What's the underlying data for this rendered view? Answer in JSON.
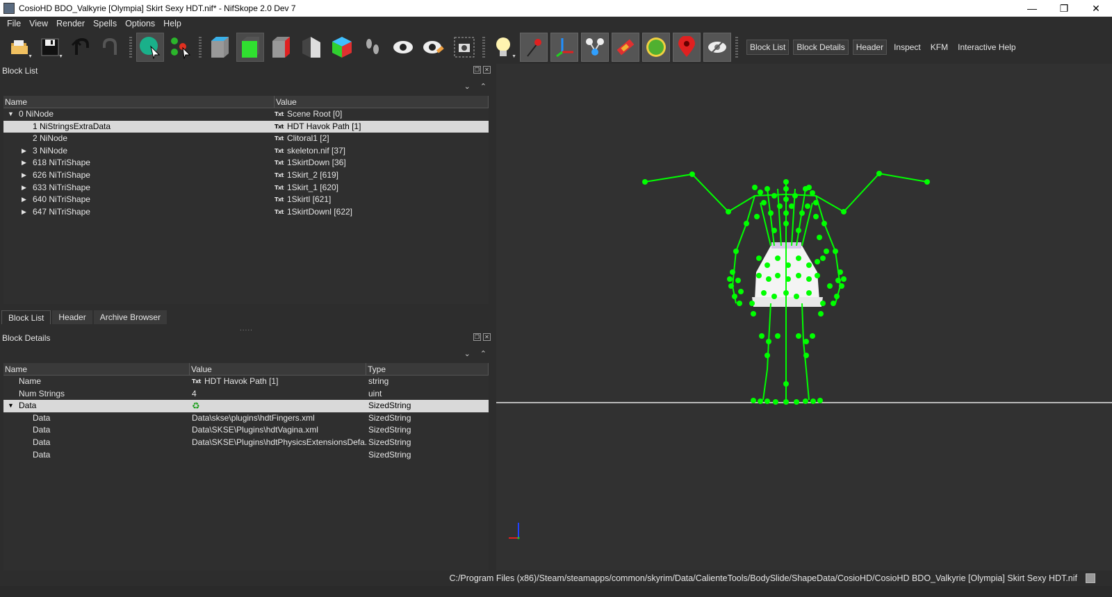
{
  "window": {
    "title": "CosioHD BDO_Valkyrie [Olympia] Skirt Sexy HDT.nif* - NifSkope 2.0 Dev 7",
    "minimize_glyph": "—",
    "restore_glyph": "❐",
    "close_glyph": "✕"
  },
  "menu": [
    "File",
    "View",
    "Render",
    "Spells",
    "Options",
    "Help"
  ],
  "toolbar": {
    "icons": [
      "open-icon",
      "save-icon",
      "undo-icon",
      "redo-icon",
      "select-icon",
      "nodes-icon",
      "cube-blue-icon",
      "cube-green-icon",
      "cube-red-icon",
      "half-icon",
      "color-cube-icon",
      "footprint-icon",
      "eye-icon",
      "eye-pencil-icon",
      "screenshot-icon",
      "lightbulb-icon",
      "pin-icon",
      "axes-icon",
      "nodes-graph-icon",
      "gradient-icon",
      "globe-icon",
      "location-icon",
      "hidden-eye-icon"
    ],
    "text_buttons": [
      "Block List",
      "Block Details",
      "Header",
      "Inspect",
      "KFM",
      "Interactive Help"
    ]
  },
  "block_list": {
    "title": "Block List",
    "columns": [
      "Name",
      "Value"
    ],
    "rows": [
      {
        "name": "0 NiNode",
        "value": "Scene Root [0]",
        "indent": 0,
        "expander": "▼",
        "icon": "Txt"
      },
      {
        "name": "1 NiStringsExtraData",
        "value": "HDT Havok Path [1]",
        "indent": 1,
        "expander": "",
        "icon": "Txt"
      },
      {
        "name": "2 NiNode",
        "value": "Clitoral1 [2]",
        "indent": 1,
        "expander": "",
        "icon": "Txt"
      },
      {
        "name": "3 NiNode",
        "value": "skeleton.nif [37]",
        "indent": 1,
        "expander": "▶",
        "icon": "Txt"
      },
      {
        "name": "618 NiTriShape",
        "value": "1SkirtDown [36]",
        "indent": 1,
        "expander": "▶",
        "icon": "Txt"
      },
      {
        "name": "626 NiTriShape",
        "value": "1Skirt_2 [619]",
        "indent": 1,
        "expander": "▶",
        "icon": "Txt"
      },
      {
        "name": "633 NiTriShape",
        "value": "1Skirt_1 [620]",
        "indent": 1,
        "expander": "▶",
        "icon": "Txt"
      },
      {
        "name": "640 NiTriShape",
        "value": "1Skirtl [621]",
        "indent": 1,
        "expander": "▶",
        "icon": "Txt"
      },
      {
        "name": "647 NiTriShape",
        "value": "1SkirtDownl [622]",
        "indent": 1,
        "expander": "▶",
        "icon": "Txt"
      }
    ]
  },
  "tabs": [
    "Block List",
    "Header",
    "Archive Browser"
  ],
  "block_details": {
    "title": "Block Details",
    "columns": [
      "Name",
      "Value",
      "Type"
    ],
    "rows": [
      {
        "name": "Name",
        "value": "HDT Havok Path [1]",
        "type": "string",
        "indent": 1,
        "expander": "",
        "icon": "Txt"
      },
      {
        "name": "Num Strings",
        "value": "4",
        "type": "uint",
        "indent": 1,
        "expander": "",
        "icon": ""
      },
      {
        "name": "Data",
        "value": "",
        "type": "SizedString",
        "indent": 1,
        "expander": "▼",
        "icon": "link"
      },
      {
        "name": "Data",
        "value": "Data\\skse\\plugins\\hdtFingers.xml",
        "type": "SizedString",
        "indent": 2,
        "expander": "",
        "icon": ""
      },
      {
        "name": "Data",
        "value": "Data\\SKSE\\Plugins\\hdtVagina.xml",
        "type": "SizedString",
        "indent": 2,
        "expander": "",
        "icon": ""
      },
      {
        "name": "Data",
        "value": "Data\\SKSE\\Plugins\\hdtPhysicsExtensionsDefa...",
        "type": "SizedString",
        "indent": 2,
        "expander": "",
        "icon": ""
      },
      {
        "name": "Data",
        "value": "",
        "type": "SizedString",
        "indent": 2,
        "expander": "",
        "icon": ""
      }
    ]
  },
  "status": {
    "path": "C:/Program Files (x86)/Steam/steamapps/common/skyrim/Data/CalienteTools/BodySlide/ShapeData/CosioHD/CosioHD BDO_Valkyrie [Olympia] Skirt Sexy HDT.nif"
  },
  "colors": {
    "bone": "#00ff00",
    "ground": "#e8e8e8",
    "selection": "#d9d9d9",
    "background": "#2d2d2d"
  }
}
